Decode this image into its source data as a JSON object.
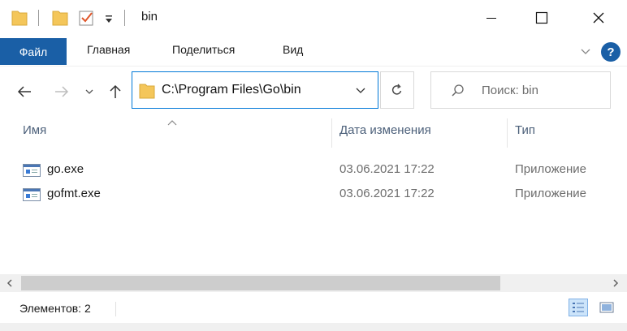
{
  "window": {
    "title": "bin",
    "controls": {
      "minimize": "—",
      "maximize": "☐",
      "close": "✕"
    }
  },
  "ribbon": {
    "tabs": [
      "Файл",
      "Главная",
      "Поделиться",
      "Вид"
    ],
    "help_icon": "?"
  },
  "navigation": {
    "address": "C:\\Program Files\\Go\\bin",
    "search_placeholder": "Поиск: bin"
  },
  "columns": {
    "name": "Имя",
    "date": "Дата изменения",
    "type": "Тип"
  },
  "files": [
    {
      "name": "go.exe",
      "date": "03.06.2021 17:22",
      "type": "Приложение"
    },
    {
      "name": "gofmt.exe",
      "date": "03.06.2021 17:22",
      "type": "Приложение"
    }
  ],
  "status": {
    "items_count": "Элементов: 2"
  },
  "colors": {
    "file_tab": "#1a5fa6",
    "address_border": "#0078d7",
    "folder": "#f4c65a",
    "help": "#1a5fa6"
  }
}
